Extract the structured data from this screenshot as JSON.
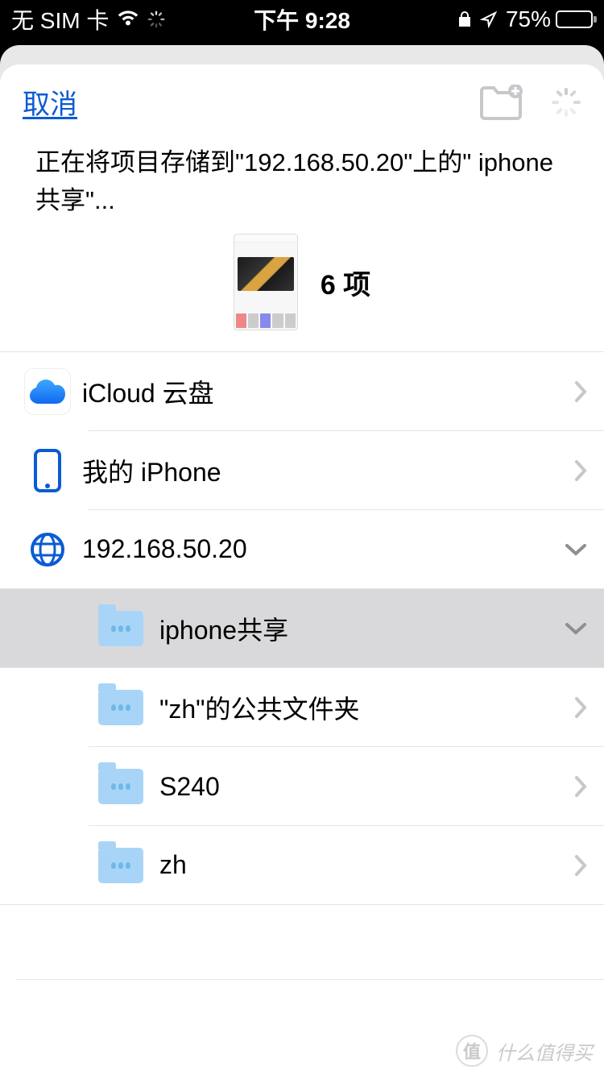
{
  "status_bar": {
    "sim": "无 SIM 卡",
    "time": "下午 9:28",
    "battery_percent": "75%"
  },
  "sheet": {
    "cancel_label": "取消",
    "status_message": "正在将项目存储到\"192.168.50.20\"上的\" iphone共享\"...",
    "item_count": "6 项"
  },
  "locations": [
    {
      "id": "icloud",
      "label": "iCloud 云盘",
      "icon": "icloud",
      "indent": 0,
      "arrow": "right",
      "selected": false
    },
    {
      "id": "myiphone",
      "label": "我的 iPhone",
      "icon": "iphone",
      "indent": 0,
      "arrow": "right",
      "selected": false
    },
    {
      "id": "server",
      "label": "192.168.50.20",
      "icon": "globe",
      "indent": 0,
      "arrow": "down",
      "selected": false
    },
    {
      "id": "iphone-share",
      "label": "iphone共享",
      "icon": "folder",
      "indent": 1,
      "arrow": "down",
      "selected": true
    },
    {
      "id": "zh-public",
      "label": "\"zh\"的公共文件夹",
      "icon": "folder",
      "indent": 1,
      "arrow": "right",
      "selected": false
    },
    {
      "id": "s240",
      "label": "S240",
      "icon": "folder",
      "indent": 1,
      "arrow": "right",
      "selected": false
    },
    {
      "id": "zh",
      "label": "zh",
      "icon": "folder",
      "indent": 1,
      "arrow": "right",
      "selected": false
    }
  ],
  "watermark": {
    "badge": "值",
    "text": "什么值得买"
  }
}
